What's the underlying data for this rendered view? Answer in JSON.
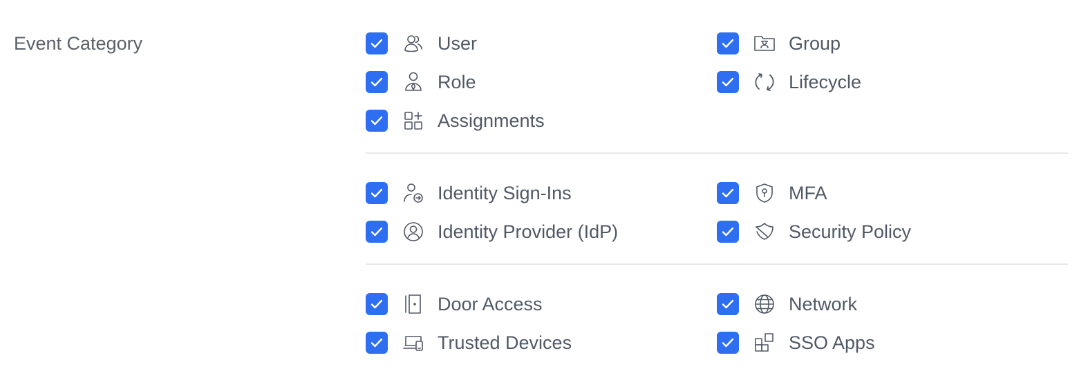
{
  "section": {
    "label": "Event Category"
  },
  "accent_color": "#2e6ff2",
  "groups": [
    {
      "items": [
        {
          "label": "User",
          "icon": "users-icon",
          "checked": true
        },
        {
          "label": "Group",
          "icon": "group-icon",
          "checked": true
        },
        {
          "label": "Role",
          "icon": "role-icon",
          "checked": true
        },
        {
          "label": "Lifecycle",
          "icon": "lifecycle-icon",
          "checked": true
        },
        {
          "label": "Assignments",
          "icon": "assignments-icon",
          "checked": true
        }
      ]
    },
    {
      "items": [
        {
          "label": "Identity Sign-Ins",
          "icon": "identity-sign-in-icon",
          "checked": true
        },
        {
          "label": "MFA",
          "icon": "mfa-shield-icon",
          "checked": true
        },
        {
          "label": "Identity Provider (IdP)",
          "icon": "identity-provider-icon",
          "checked": true
        },
        {
          "label": "Security Policy",
          "icon": "security-policy-icon",
          "checked": true
        }
      ]
    },
    {
      "items": [
        {
          "label": "Door Access",
          "icon": "door-icon",
          "checked": true
        },
        {
          "label": "Network",
          "icon": "globe-icon",
          "checked": true
        },
        {
          "label": "Trusted Devices",
          "icon": "trusted-devices-icon",
          "checked": true
        },
        {
          "label": "SSO Apps",
          "icon": "sso-apps-icon",
          "checked": true
        }
      ]
    }
  ]
}
